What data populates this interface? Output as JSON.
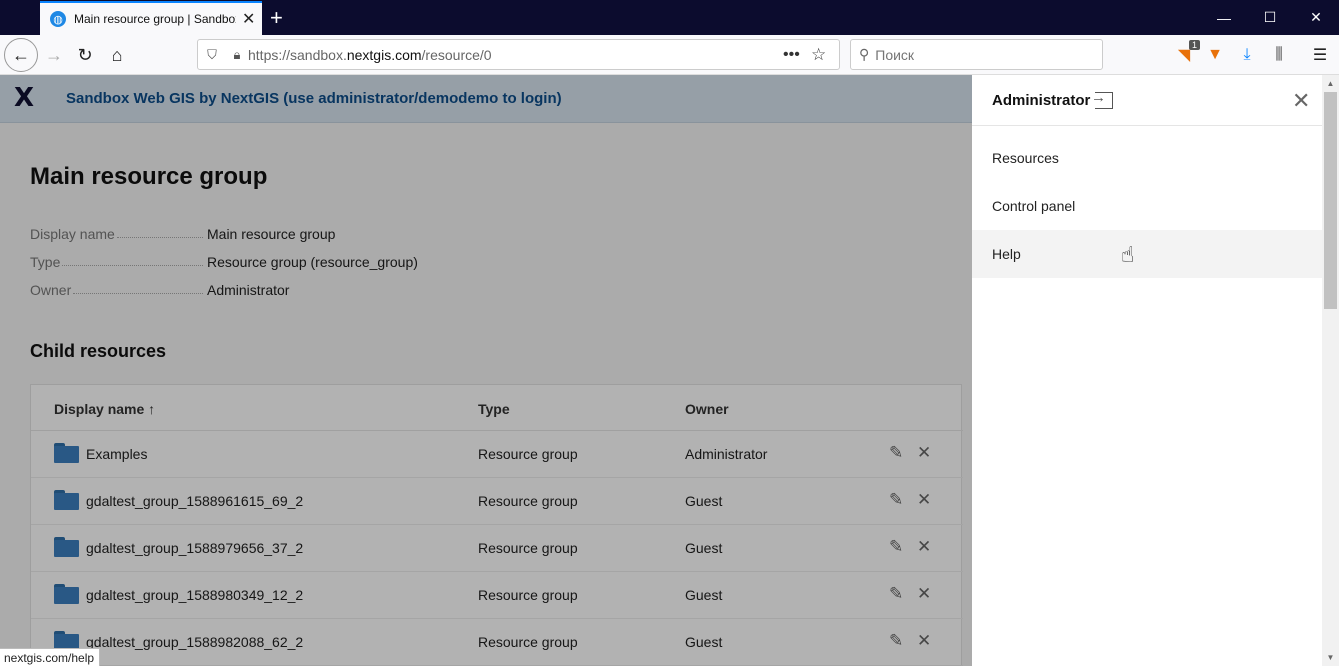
{
  "browser": {
    "tab_title": "Main resource group | Sandbox",
    "tab_close": "✕",
    "new_tab": "+",
    "url_prefix": "https://sandbox.",
    "url_domain": "nextgis.com",
    "url_path": "/resource/0",
    "search_placeholder": "Поиск",
    "ext_badge": "1",
    "status_url": "nextgis.com/help"
  },
  "app": {
    "logo": "X",
    "title": "Sandbox Web GIS by NextGIS (use administrator/demodemo to login)"
  },
  "page": {
    "title": "Main resource group",
    "properties": [
      {
        "label": "Display name",
        "value": "Main resource group"
      },
      {
        "label": "Type",
        "value": "Resource group (resource_group)"
      },
      {
        "label": "Owner",
        "value": "Administrator"
      }
    ],
    "section_title": "Child resources",
    "table": {
      "columns": [
        "Display name",
        "Type",
        "Owner"
      ],
      "sort_indicator": "↑",
      "rows": [
        {
          "name": "Examples",
          "type": "Resource group",
          "owner": "Administrator"
        },
        {
          "name": "gdaltest_group_1588961615_69_2",
          "type": "Resource group",
          "owner": "Guest"
        },
        {
          "name": "gdaltest_group_1588979656_37_2",
          "type": "Resource group",
          "owner": "Guest"
        },
        {
          "name": "gdaltest_group_1588980349_12_2",
          "type": "Resource group",
          "owner": "Guest"
        },
        {
          "name": "gdaltest_group_1588982088_62_2",
          "type": "Resource group",
          "owner": "Guest"
        }
      ]
    }
  },
  "drawer": {
    "user": "Administrator",
    "menu": [
      "Resources",
      "Control panel",
      "Help"
    ],
    "hovered_item": "Help"
  },
  "colors": {
    "accent": "#0a84ff",
    "header_bg": "#d7e4f0",
    "app_title": "#0c4d8a",
    "folder": "#3b7fbf"
  }
}
